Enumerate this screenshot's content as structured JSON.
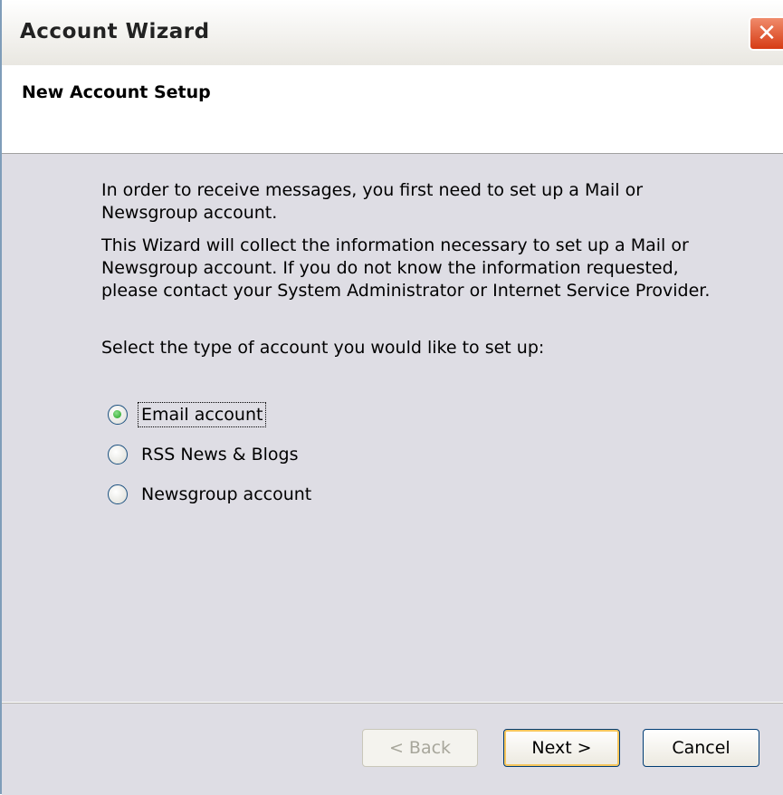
{
  "window": {
    "title": "Account Wizard",
    "close_glyph": "✕"
  },
  "header": {
    "title": "New Account Setup"
  },
  "content": {
    "paragraph1": "In order to receive messages, you first need to set up a Mail or Newsgroup account.",
    "paragraph2": "This Wizard will collect the information necessary to set up a Mail or Newsgroup account. If you do not know the information requested, please contact your System Administrator or Internet Service Provider.",
    "prompt": "Select the type of account you would like to set up:",
    "options": [
      {
        "label": "Email account",
        "selected": true
      },
      {
        "label": "RSS News & Blogs",
        "selected": false
      },
      {
        "label": "Newsgroup account",
        "selected": false
      }
    ]
  },
  "footer": {
    "back_label": "< Back",
    "next_label": "Next >",
    "cancel_label": "Cancel"
  }
}
